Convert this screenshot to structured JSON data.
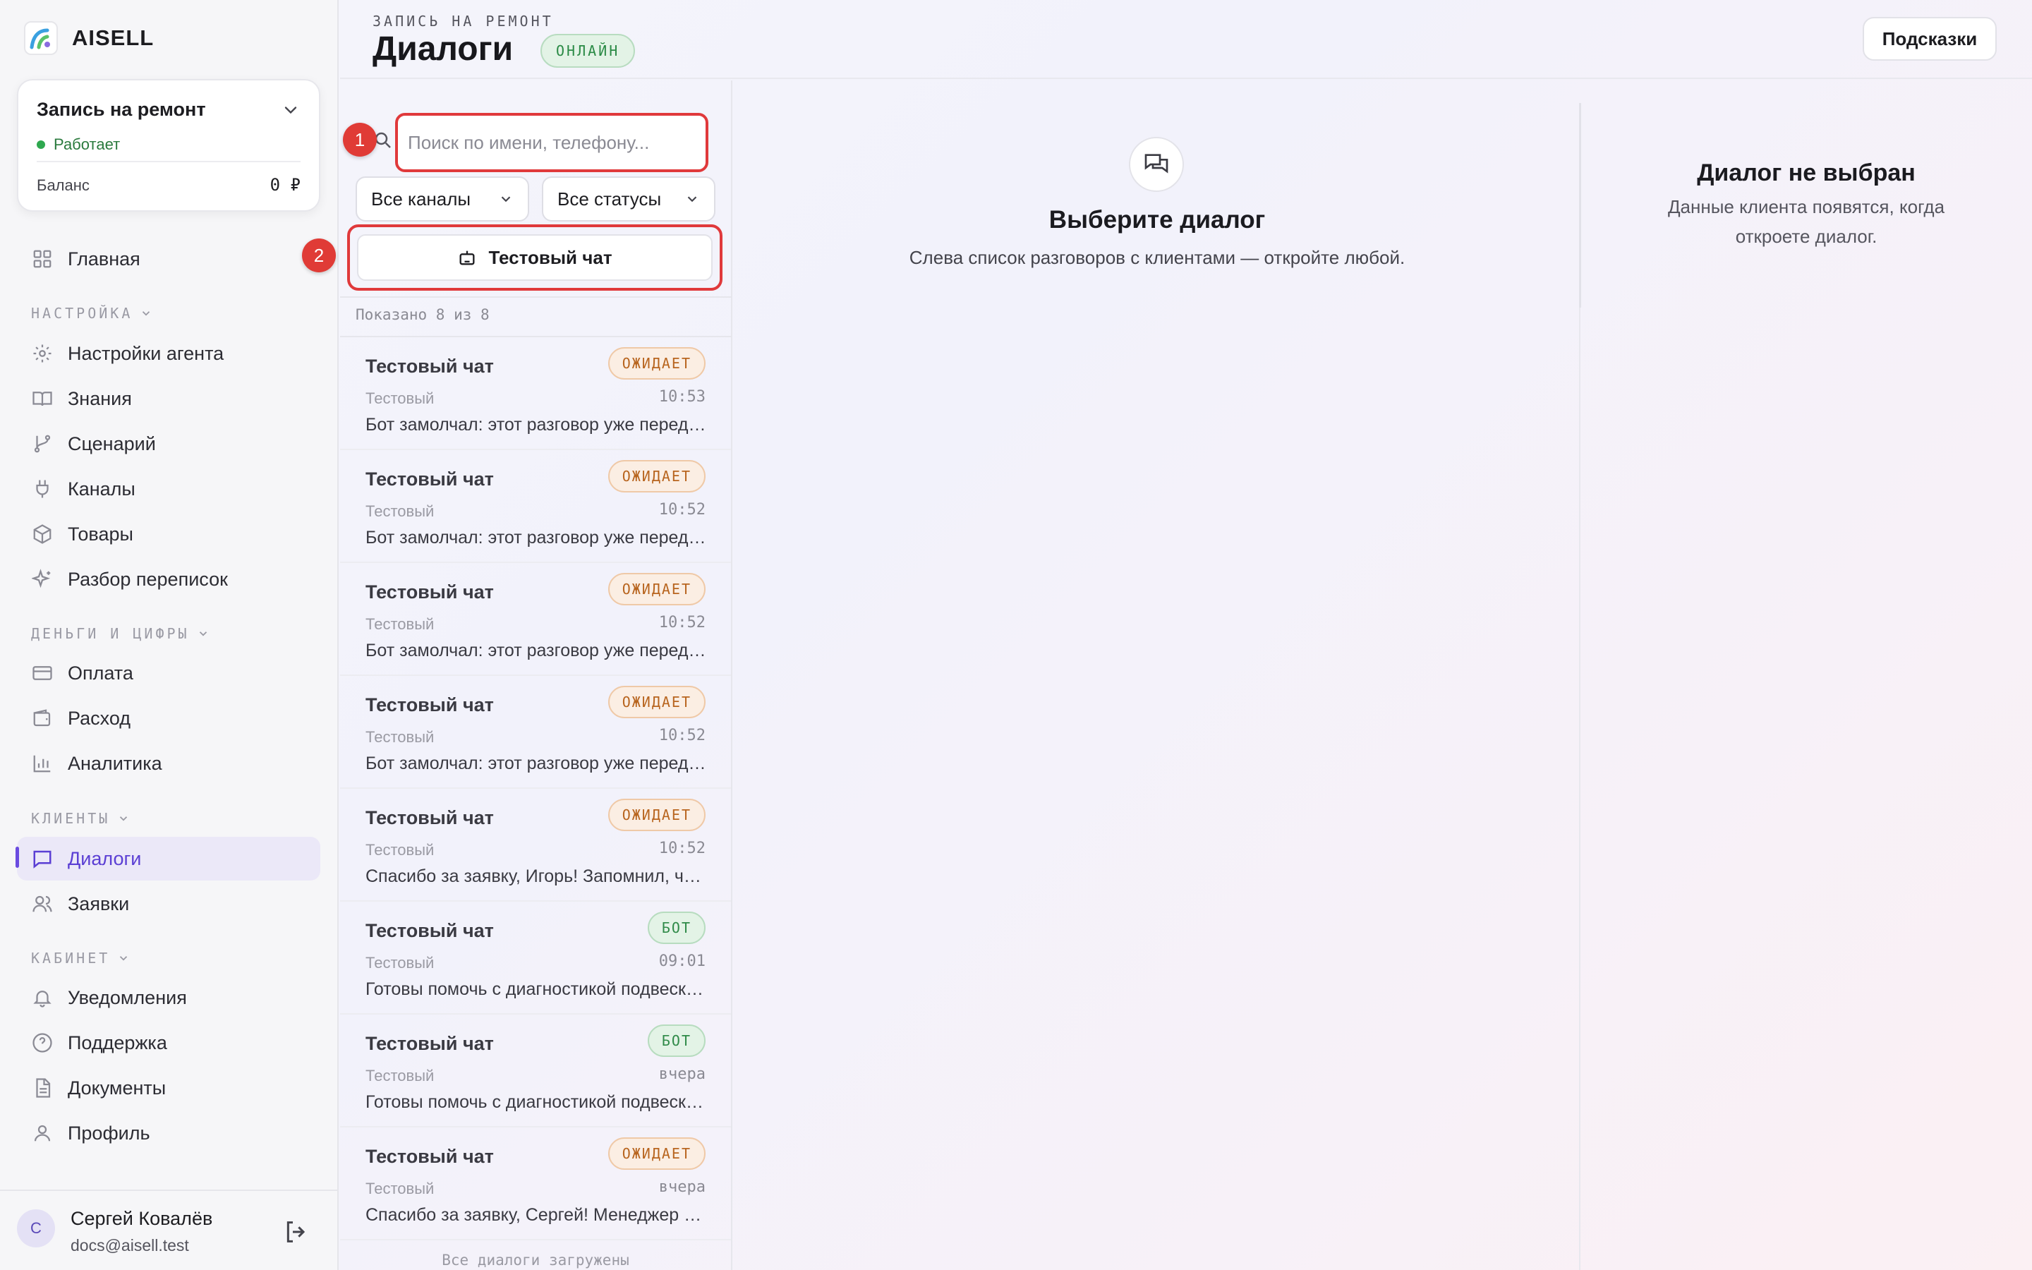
{
  "brand": {
    "name": "AISELL"
  },
  "project": {
    "title": "Запись на ремонт",
    "status": "Работает",
    "balance_label": "Баланс",
    "balance_value": "0 ₽"
  },
  "nav": {
    "home": "Главная",
    "section_settings": "НАСТРОЙКА",
    "agent_settings": "Настройки агента",
    "knowledge": "Знания",
    "scenario": "Сценарий",
    "channels": "Каналы",
    "goods": "Товары",
    "review": "Разбор переписок",
    "section_money": "ДЕНЬГИ И ЦИФРЫ",
    "payment": "Оплата",
    "expense": "Расход",
    "analytics": "Аналитика",
    "section_clients": "КЛИЕНТЫ",
    "dialogs": "Диалоги",
    "requests": "Заявки",
    "section_cabinet": "КАБИНЕТ",
    "notifications": "Уведомления",
    "support": "Поддержка",
    "documents": "Документы",
    "profile": "Профиль"
  },
  "user": {
    "initial": "С",
    "name": "Сергей Ковалёв",
    "email": "docs@aisell.test"
  },
  "header": {
    "crumb": "ЗАПИСЬ НА РЕМОНТ",
    "title": "Диалоги",
    "status_badge": "ОНЛАЙН",
    "hints_button": "Подсказки"
  },
  "list": {
    "search_placeholder": "Поиск по имени, телефону...",
    "search_value": "",
    "channel_filter": "Все каналы",
    "status_filter": "Все статусы",
    "test_chat_button": "Тестовый чат",
    "marker_1": "1",
    "marker_2": "2",
    "shown_count": "Показано 8 из 8",
    "all_loaded": "Все диалоги загружены",
    "dialogs": [
      {
        "name": "Тестовый чат",
        "badge": "ОЖИДАЕТ",
        "kind": "wait",
        "channel": "Тестовый",
        "time": "10:53",
        "preview": "Бот замолчал: этот разговор уже передан оператору"
      },
      {
        "name": "Тестовый чат",
        "badge": "ОЖИДАЕТ",
        "kind": "wait",
        "channel": "Тестовый",
        "time": "10:52",
        "preview": "Бот замолчал: этот разговор уже передан оператору"
      },
      {
        "name": "Тестовый чат",
        "badge": "ОЖИДАЕТ",
        "kind": "wait",
        "channel": "Тестовый",
        "time": "10:52",
        "preview": "Бот замолчал: этот разговор уже передан оператору"
      },
      {
        "name": "Тестовый чат",
        "badge": "ОЖИДАЕТ",
        "kind": "wait",
        "channel": "Тестовый",
        "time": "10:52",
        "preview": "Бот замолчал: этот разговор уже передан оператору"
      },
      {
        "name": "Тестовый чат",
        "badge": "ОЖИДАЕТ",
        "kind": "wait",
        "channel": "Тестовый",
        "time": "10:52",
        "preview": "Спасибо за заявку, Игорь! Запомнил, что вам нужна запись"
      },
      {
        "name": "Тестовый чат",
        "badge": "БОТ",
        "kind": "bot",
        "channel": "Тестовый",
        "time": "09:01",
        "preview": "Готовы помочь с диагностикой подвески вашего автомобиля"
      },
      {
        "name": "Тестовый чат",
        "badge": "БОТ",
        "kind": "bot",
        "channel": "Тестовый",
        "time": "вчера",
        "preview": "Готовы помочь с диагностикой подвески вашего автомобиля"
      },
      {
        "name": "Тестовый чат",
        "badge": "ОЖИДАЕТ",
        "kind": "wait",
        "channel": "Тестовый",
        "time": "вчера",
        "preview": "Спасибо за заявку, Сергей! Менеджер свяжется с вами"
      }
    ]
  },
  "empty": {
    "title": "Выберите диалог",
    "subtitle": "Слева список разговоров с клиентами — откройте любой."
  },
  "right_panel": {
    "title": "Диалог не выбран",
    "subtitle": "Данные клиента появятся, когда откроете диалог."
  },
  "colors": {
    "accent": "#5b3fd4",
    "highlight": "#e0393b",
    "wait": "#b8651f",
    "bot": "#2f8a48"
  },
  "icons": [
    "logo-icon",
    "chevron-down-icon",
    "grid-icon",
    "gear-icon",
    "book-icon",
    "branch-icon",
    "plug-icon",
    "box-icon",
    "sparkle-icon",
    "card-icon",
    "wallet-icon",
    "chart-icon",
    "chat-icon",
    "users-icon",
    "bell-icon",
    "help-icon",
    "document-icon",
    "person-icon",
    "logout-icon",
    "search-icon",
    "robot-icon",
    "chat-bubbles-icon"
  ]
}
